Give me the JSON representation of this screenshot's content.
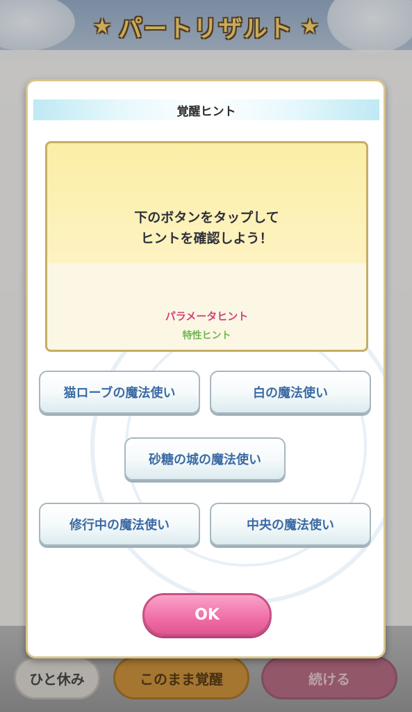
{
  "screen": {
    "title": "パートリザルト",
    "star_icon": "star-icon"
  },
  "background_buttons": {
    "rest": "ひと休み",
    "awaken": "このまま覚醒",
    "continue": "続ける"
  },
  "modal": {
    "title": "覚醒ヒント",
    "hint_message": "下のボタンをタップして\nヒントを確認しよう！",
    "parameter_hint": "パラメータヒント",
    "trait_hint": "特性ヒント",
    "mage_options": [
      "猫ローブの魔法使い",
      "白の魔法使い",
      "砂糖の城の魔法使い",
      "修行中の魔法使い",
      "中央の魔法使い"
    ],
    "ok_label": "OK"
  },
  "colors": {
    "parameter_hint": "#d54179",
    "trait_hint": "#6fb84f",
    "ok_button": "#ef6ea6",
    "mage_text": "#3a6aa3"
  }
}
